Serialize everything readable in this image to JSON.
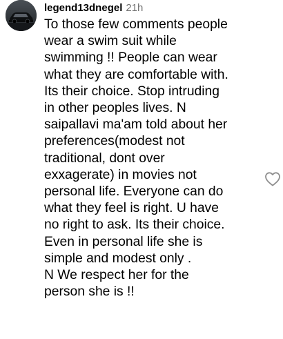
{
  "comment": {
    "username": "legend13dnegel",
    "timestamp": "21h",
    "text": "To those few comments people\nwear a swim suit while\nswimming !! People can wear\nwhat they are comfortable with.\nIts their choice. Stop intruding\nin other peoples lives. N\nsaipallavi ma'am told about her\npreferences(modest not\ntraditional, dont over\nexxagerate) in movies not\npersonal life. Everyone can do\nwhat they feel is right. U have\nno right to ask. Its their choice.\nEven in personal life she is\nsimple and modest only .\nN We respect her for the\nperson she is !!",
    "avatar_icon": "car-avatar-icon",
    "like_icon": "heart-outline-icon"
  },
  "colors": {
    "text": "#000000",
    "secondary": "#737373",
    "icon": "#8e8e8e"
  }
}
